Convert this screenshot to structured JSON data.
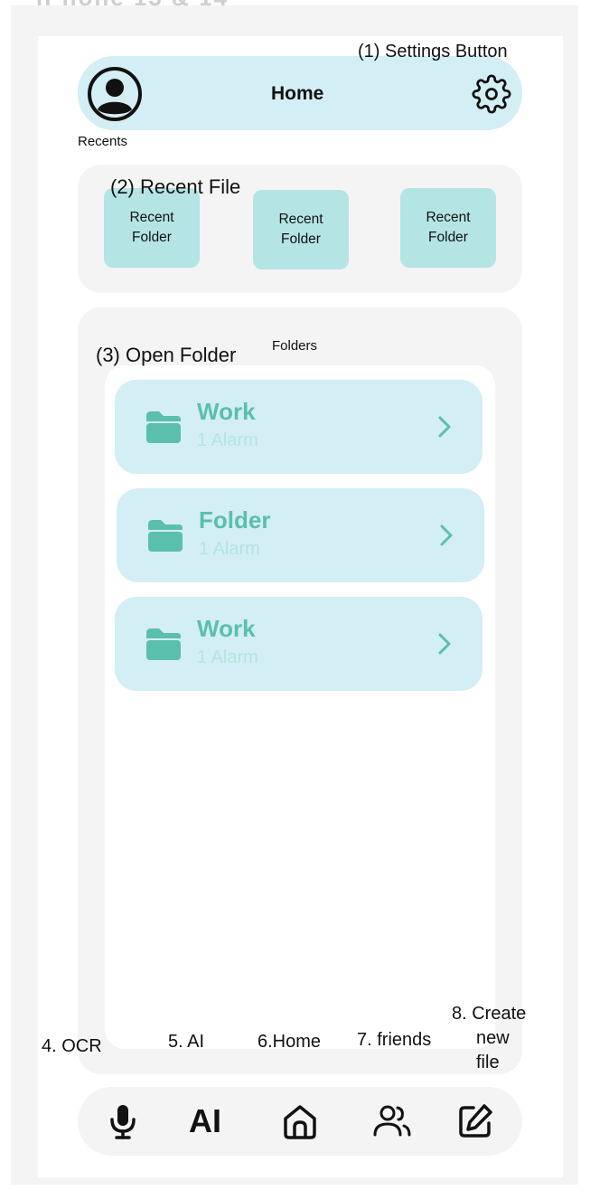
{
  "header": {
    "title": "Home",
    "settings_annotation": "(1) Settings Button"
  },
  "recents": {
    "label": "Recents",
    "annotation": "(2) Recent File",
    "cards": [
      {
        "line1": "Recent",
        "line2": "Folder"
      },
      {
        "line1": "Recent",
        "line2": "Folder"
      },
      {
        "line1": "Recent",
        "line2": "Folder"
      }
    ]
  },
  "folders": {
    "label": "Folders",
    "annotation": "(3) Open Folder",
    "items": [
      {
        "name": "Work",
        "subtitle": "1 Alarm"
      },
      {
        "name": "Folder",
        "subtitle": "1 Alarm"
      },
      {
        "name": "Work",
        "subtitle": "1 Alarm"
      }
    ]
  },
  "nav": {
    "annotations": {
      "ocr": "4. OCR",
      "ai": "5. AI",
      "home": "6.Home",
      "friends": "7. friends",
      "create_line1": "8. Create",
      "create_line2": "new",
      "create_line3": "file"
    },
    "ai_label": "AI",
    "icons": [
      "microphone-icon",
      "ai-text",
      "home-icon",
      "friends-icon",
      "edit-icon"
    ]
  },
  "colors": {
    "header_bg": "#d3eef4",
    "recent_card": "#b4e5e4",
    "folder_accent": "#5bbfae",
    "folder_sub": "#b4e5de",
    "panel_bg": "#f4f4f4"
  }
}
